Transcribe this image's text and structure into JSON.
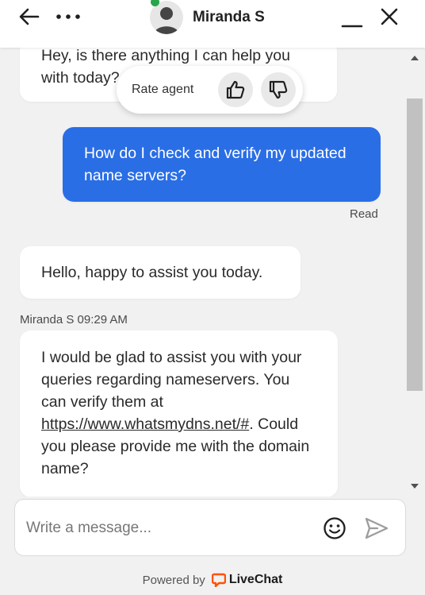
{
  "header": {
    "agent_name": "Miranda S",
    "status_color": "#27a54a",
    "icons": {
      "back": "arrow-left-icon",
      "more": "more-dots-icon",
      "minimize": "minimize-icon",
      "close": "close-icon"
    }
  },
  "rating": {
    "label": "Rate agent",
    "up_icon": "thumbs-up-icon",
    "down_icon": "thumbs-down-icon"
  },
  "messages": [
    {
      "from": "agent",
      "text": "Hey, is there anything I can help you with today?"
    },
    {
      "from": "user",
      "text": "How do I check and verify my updated name servers?",
      "status": "Read",
      "color": "#2a6ee6"
    },
    {
      "from": "agent",
      "text": "Hello, happy to assist you today."
    },
    {
      "from": "agent",
      "sender": "Miranda S",
      "time": "09:29 AM",
      "text_before": "I would be glad to assist you with your queries regarding nameservers. You can verify them at ",
      "link": "https://www.whatsmydns.net/#",
      "text_after": ". Could you please provide me with the domain name?"
    }
  ],
  "composer": {
    "placeholder": "Write a message...",
    "value": "",
    "emoji_icon": "smiley-icon",
    "send_icon": "send-icon"
  },
  "footer": {
    "powered_by": "Powered by",
    "brand": "LiveChat",
    "brand_color": "#ff5100"
  }
}
